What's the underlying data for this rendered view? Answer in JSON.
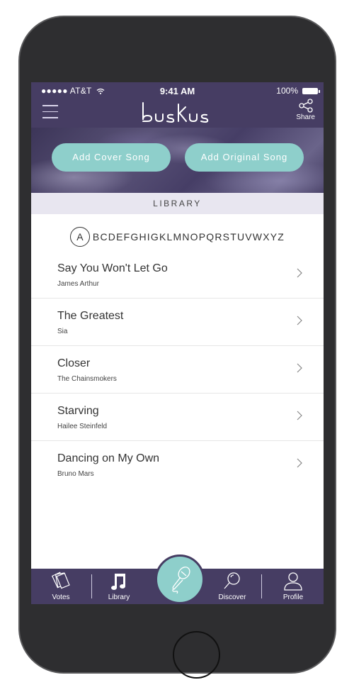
{
  "status_bar": {
    "carrier": "●●●●● AT&T",
    "time": "9:41 AM",
    "battery": "100%"
  },
  "header": {
    "logo": "busKus",
    "share_label": "Share"
  },
  "actions": {
    "add_cover": "Add Cover Song",
    "add_original": "Add Original Song"
  },
  "library": {
    "title": "LIBRARY",
    "selected_letter": "A",
    "letters": "BCDEFGHIGKLMNOPQRSTUVWXYZ"
  },
  "songs": [
    {
      "title": "Say You Won't Let Go",
      "artist": "James Arthur"
    },
    {
      "title": "The Greatest",
      "artist": "Sia"
    },
    {
      "title": "Closer",
      "artist": "The Chainsmokers"
    },
    {
      "title": "Starving",
      "artist": "Hailee Steinfeld"
    },
    {
      "title": "Dancing on My Own",
      "artist": "Bruno Mars"
    }
  ],
  "tabs": {
    "votes": "Votes",
    "library": "Library",
    "discover": "Discover",
    "profile": "Profile"
  },
  "colors": {
    "header_bg": "#463d63",
    "accent": "#8ecfcb"
  },
  "icons": [
    "wifi-icon",
    "battery-icon",
    "menu-icon",
    "share-icon",
    "chevron-right-icon",
    "cards-icon",
    "music-note-icon",
    "microphone-icon",
    "search-icon",
    "profile-icon"
  ]
}
